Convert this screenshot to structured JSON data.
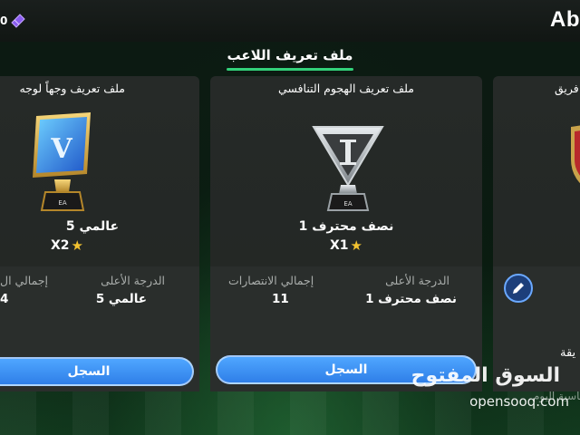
{
  "header": {
    "coin_value": "0",
    "brand": "Ab",
    "title": "ملف تعريف اللاعب",
    "accent": "#33d17a"
  },
  "cards": [
    {
      "title": "ملف تعريف وجهاً لوجه",
      "rank_name": "عالمي 5",
      "multiplier": "X2",
      "trophy_icon": "elite-blue-v-trophy-icon",
      "stat1_label": "الدرجة الأعلى",
      "stat1_value": "عالمي 5",
      "stat2_label": "إجمالي ال",
      "stat2_value": "4",
      "button": "السجل"
    },
    {
      "title": "ملف تعريف الهجوم التنافسي",
      "rank_name": "نصف محترف 1",
      "multiplier": "X1",
      "trophy_icon": "silver-i-trophy-icon",
      "stat1_label": "الدرجة الأعلى",
      "stat1_value": "نصف محترف 1",
      "stat2_label": "إجمالي الانتصارات",
      "stat2_value": "11",
      "button": "السجل"
    },
    {
      "title": "فريق",
      "trophy_icon": "red-gold-crest-icon",
      "stat_fragment": "يقة",
      "footer_fragment": "أساسية اليوم"
    }
  ],
  "watermark": {
    "arabic": "السوق المفتوح",
    "latin": "opensooq.com"
  },
  "colors": {
    "button_blue": "#3a8cf0",
    "star_gold": "#f2c230",
    "card_bg": "#262a28"
  }
}
